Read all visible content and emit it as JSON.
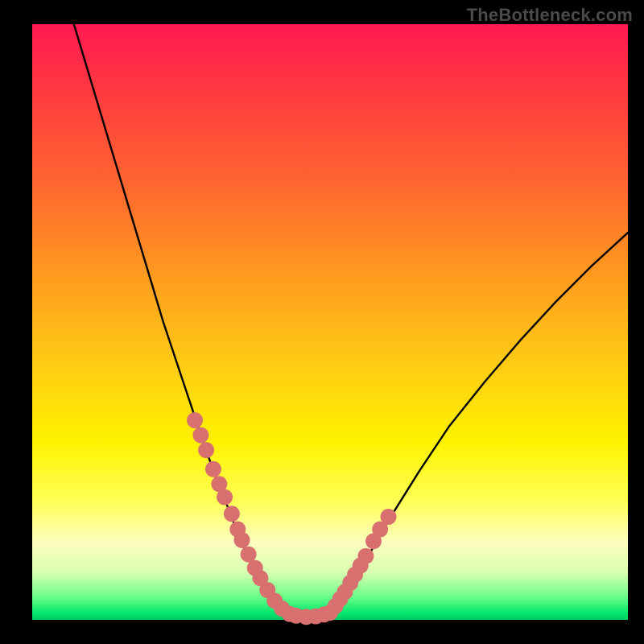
{
  "watermark": "TheBottleneck.com",
  "chart_data": {
    "type": "line",
    "title": "",
    "xlabel": "",
    "ylabel": "",
    "xlim": [
      0,
      100
    ],
    "ylim": [
      0,
      100
    ],
    "grid": false,
    "legend": false,
    "annotations": [
      "TheBottleneck.com"
    ],
    "series": [
      {
        "name": "left-curve",
        "x": [
          7,
          10,
          13,
          16,
          19,
          22,
          25,
          27,
          29,
          31,
          33,
          34.5,
          36,
          37.5,
          39,
          40.5,
          42
        ],
        "y": [
          100,
          90,
          80,
          70,
          60,
          50,
          41,
          35,
          29,
          23.5,
          18.5,
          14.5,
          11,
          8,
          5.2,
          3,
          1.2
        ]
      },
      {
        "name": "flat-valley",
        "x": [
          42,
          44,
          46,
          48,
          50
        ],
        "y": [
          1.2,
          0.6,
          0.5,
          0.6,
          1.2
        ]
      },
      {
        "name": "right-curve",
        "x": [
          50,
          53,
          56,
          60,
          65,
          70,
          76,
          82,
          88,
          94,
          100
        ],
        "y": [
          1.2,
          5,
          10,
          17,
          25,
          32.5,
          40,
          47,
          53.5,
          59.5,
          65
        ]
      }
    ],
    "highlight_points_left": {
      "name": "left-cluster-dots",
      "x": [
        27.3,
        28.3,
        29.2,
        30.4,
        31.4,
        32.3,
        33.5,
        34.5,
        35.2,
        36.3,
        37.4,
        38.3,
        39.5,
        40.7,
        41.9,
        43.2,
        44.3,
        46.0,
        47.6,
        49.0
      ],
      "y": [
        33.5,
        31.0,
        28.5,
        25.3,
        22.8,
        20.6,
        17.8,
        15.2,
        13.4,
        11.0,
        8.7,
        7.0,
        5.0,
        3.2,
        1.9,
        1.0,
        0.7,
        0.5,
        0.6,
        0.9
      ]
    },
    "highlight_points_right": {
      "name": "right-cluster-dots",
      "x": [
        50.0,
        50.9,
        51.7,
        52.5,
        53.4,
        54.2,
        55.1,
        56.0,
        57.3,
        58.4,
        59.8
      ],
      "y": [
        1.2,
        2.3,
        3.5,
        4.7,
        6.2,
        7.6,
        9.1,
        10.7,
        13.2,
        15.2,
        17.3
      ]
    },
    "marker_radius_pct": 1.35
  }
}
